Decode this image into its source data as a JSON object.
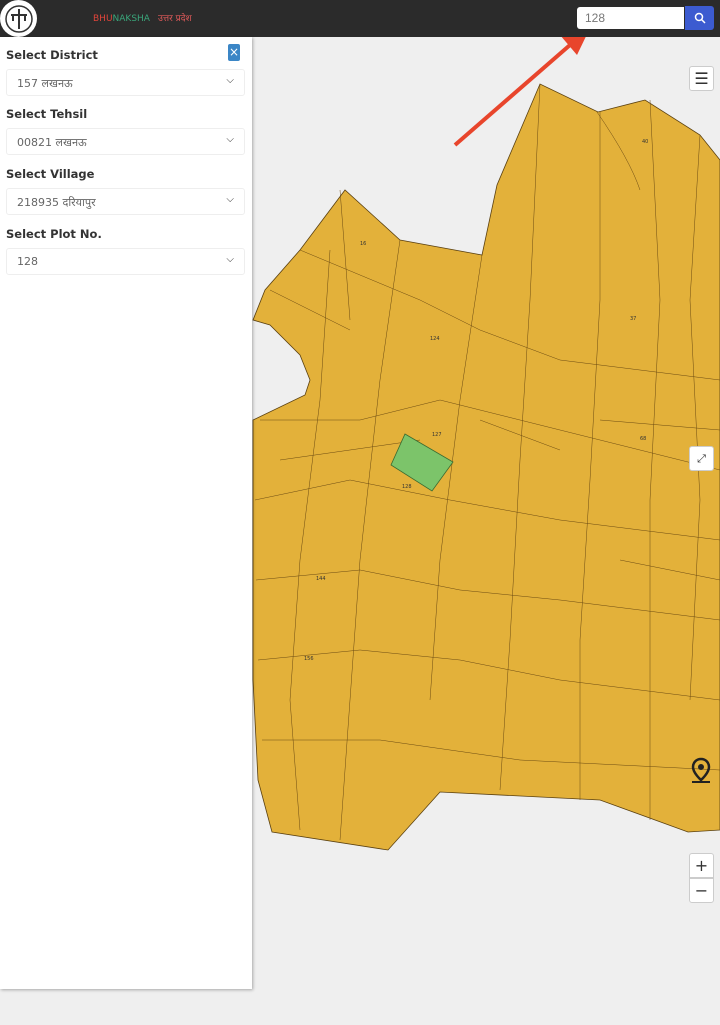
{
  "header": {
    "brand_part1": "BHU",
    "brand_part2": "NAKSHA",
    "state": "उत्तर प्रदेश",
    "search_value": "128"
  },
  "sidebar": {
    "district_label": "Select District",
    "district_value": "157 लखनऊ",
    "tehsil_label": "Select Tehsil",
    "tehsil_value": "00821 लखनऊ",
    "village_label": "Select Village",
    "village_value": "218935 दरियापुर",
    "plot_label": "Select Plot No.",
    "plot_value": "128",
    "close_label": "×"
  },
  "map": {
    "plot_fill": "#e3b13a",
    "selected_fill": "#7cc46a",
    "zoom_in": "+",
    "zoom_out": "−",
    "selected_plot": "128",
    "plot_labels": [
      "128",
      "127",
      "124",
      "144",
      "156",
      "40",
      "16",
      "37",
      "68"
    ]
  },
  "annotations": {
    "arrow_color": "#e8452c"
  }
}
